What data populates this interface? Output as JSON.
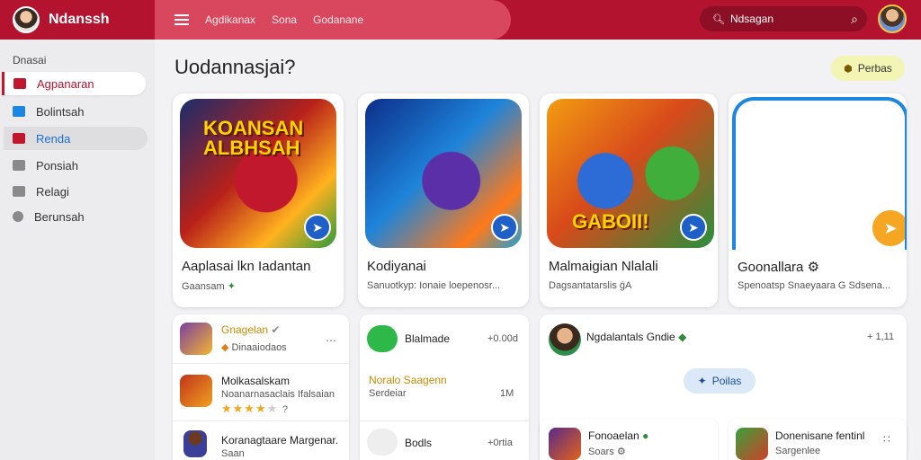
{
  "header": {
    "brand": "Ndanssh",
    "nav_links": [
      "Agdikanax",
      "Sona",
      "Godanane"
    ],
    "search_value": "Ndsagan",
    "colors": {
      "header": "#b3132f",
      "nav_pill": "#d9475e",
      "search": "#8c0f25"
    }
  },
  "sidebar": {
    "heading": "Dnasai",
    "items": [
      {
        "label": "Agpanaran",
        "icon": "store-icon",
        "color": "#c0172f"
      },
      {
        "label": "Bolintsah",
        "icon": "folder-icon",
        "color": "#1d86df"
      },
      {
        "label": "Renda",
        "icon": "grid-icon",
        "color": "#c0172f"
      },
      {
        "label": "Ponsiah",
        "icon": "file-icon",
        "color": "#777777"
      },
      {
        "label": "Relagi",
        "icon": "image-icon",
        "color": "#777777"
      },
      {
        "label": "Berunsah",
        "icon": "settings-icon",
        "color": "#777777"
      }
    ]
  },
  "main": {
    "title": "Uodannasjai?",
    "action_button": "Perbas",
    "featured": [
      {
        "art_text": "KOANSAN ALBHSAH",
        "title": "Aaplasai lkn Iadantan",
        "subtitle": "Gaansam"
      },
      {
        "art_text": "",
        "title": "Kodiyanai",
        "subtitle": "Sanuotkyp: Ionaie loepenosr..."
      },
      {
        "art_text": "GABOII!",
        "title": "Malmaigian Nlalali",
        "subtitle": "Dagsantatarslis ǵA"
      },
      {
        "art_text": "",
        "title": "Goonallara",
        "subtitle": "Spenoatsp Snaeyaara G Sdsena..."
      }
    ]
  },
  "lists": {
    "left": [
      {
        "title": "Gnagelan",
        "subtitle": "Dinaaiodaos"
      },
      {
        "title": "Molkasalskam",
        "subtitle": "Noanarnasaclais Ifalsaian",
        "rating": 4
      },
      {
        "title": "Koranagtaare Margenar.",
        "subtitle": "Saan"
      }
    ],
    "middle": [
      {
        "title": "Blalmade",
        "value": "+0.00d"
      },
      {
        "title": "Noralo Saagenn",
        "subtitle": "Serdeiar",
        "value": "1M"
      },
      {
        "title": "Bodls",
        "value": "+0rtia"
      }
    ],
    "right": {
      "header": "Ngdalantals Gndie",
      "header_value": "+ 1,11",
      "button": "Poilas",
      "bottom": [
        {
          "title": "Fonoaelan",
          "subtitle": "Soars"
        },
        {
          "title": "Donenisane fentinl",
          "subtitle": "Sargenlee"
        }
      ]
    }
  }
}
